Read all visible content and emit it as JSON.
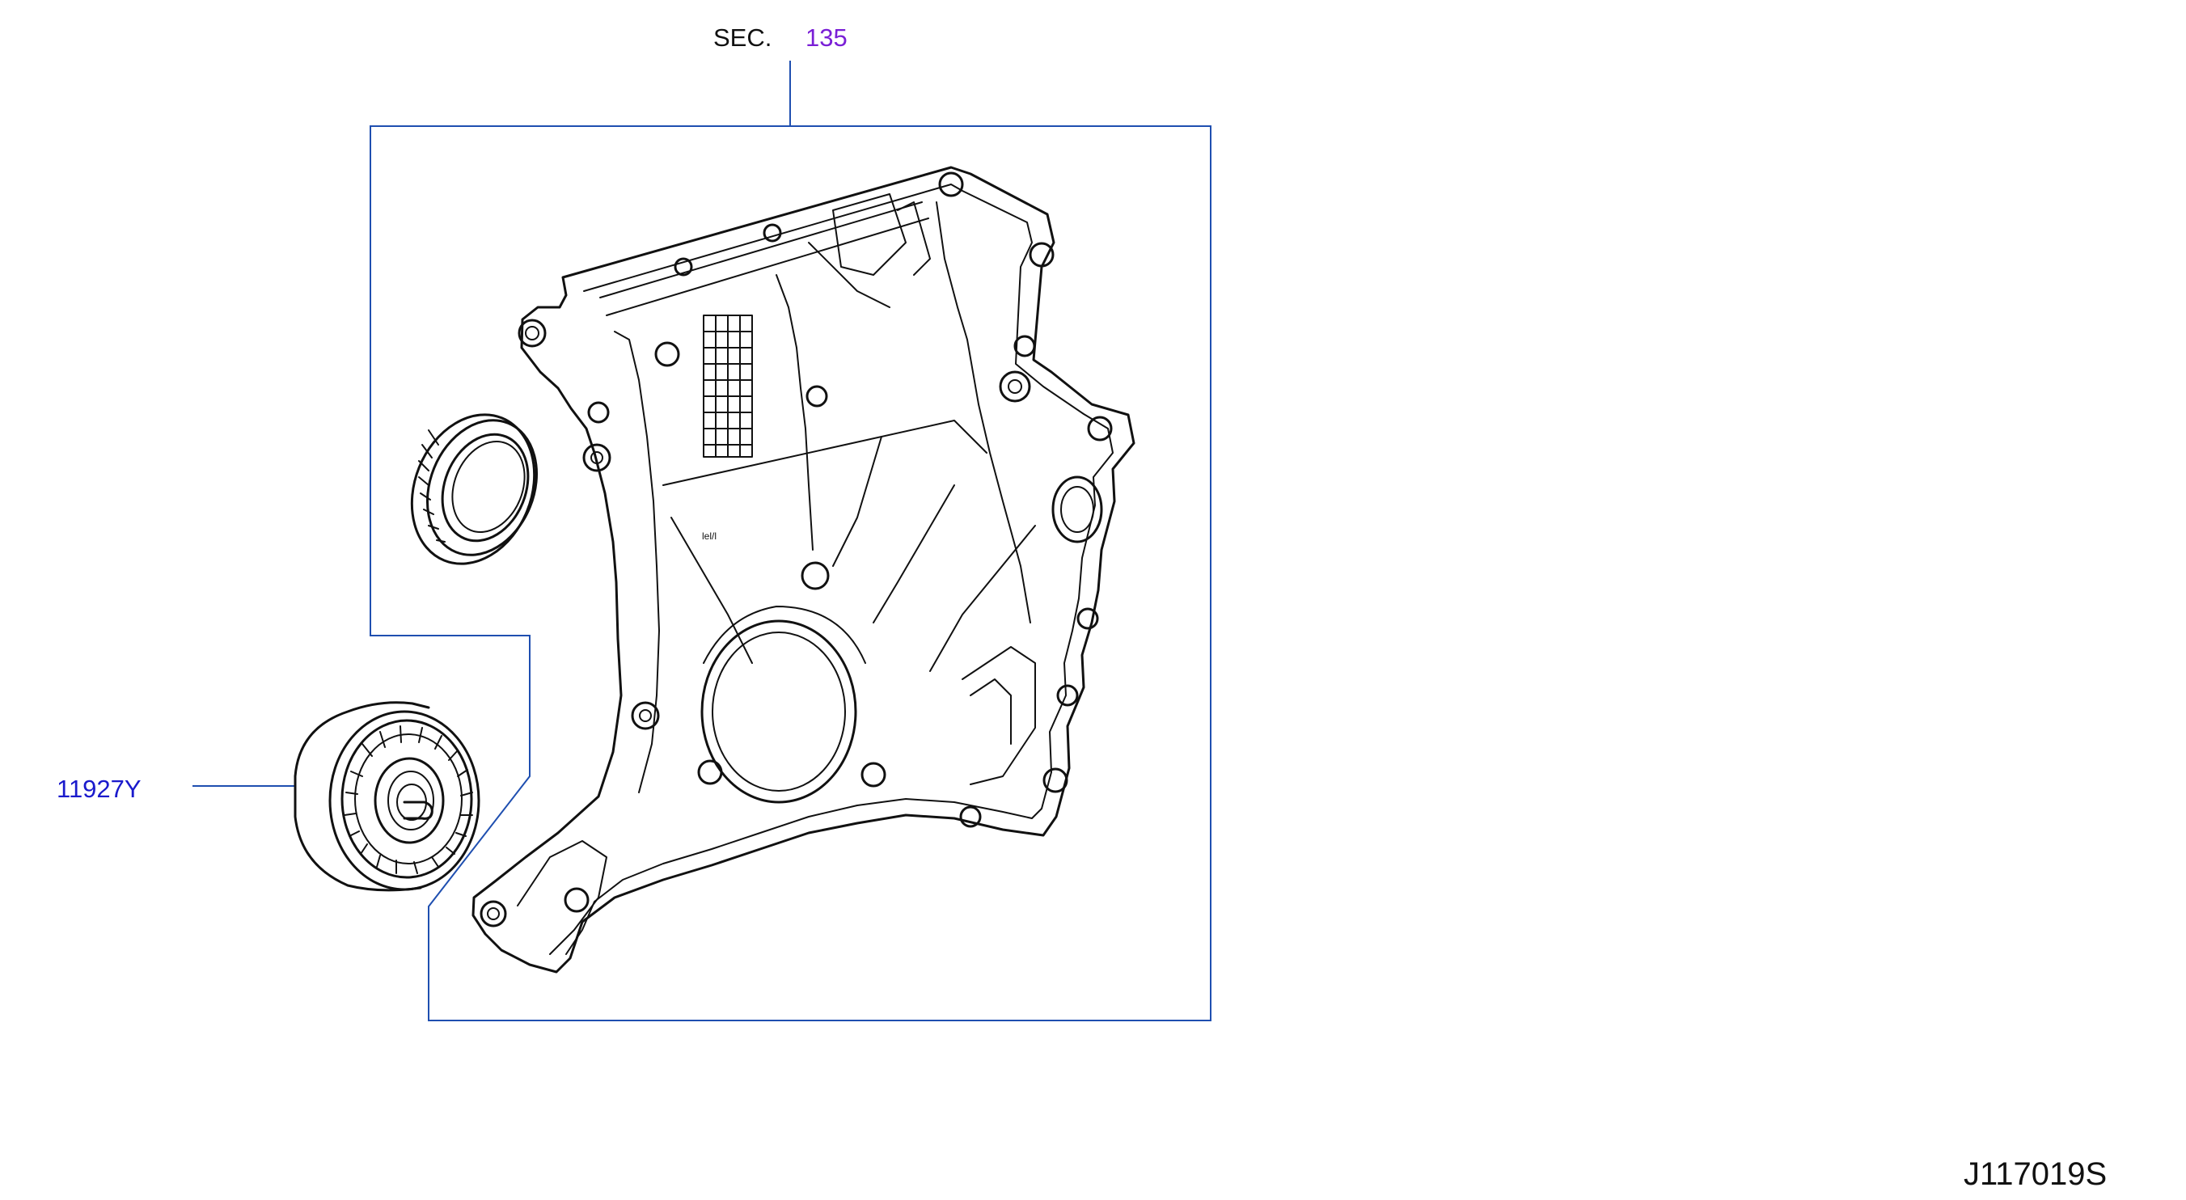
{
  "section_reference": {
    "prefix": "SEC.",
    "number": "135"
  },
  "parts": [
    {
      "label": "11927Y"
    }
  ],
  "figure_id": "J117019S",
  "colors": {
    "line_art": "#111111",
    "leader_line": "#1f4fb0",
    "section_link": "#7a1fd6",
    "part_link": "#1a1acc"
  },
  "icons": [
    "timing-chain-cover-drawing",
    "oil-seal-drawing",
    "idler-pulley-drawing"
  ]
}
